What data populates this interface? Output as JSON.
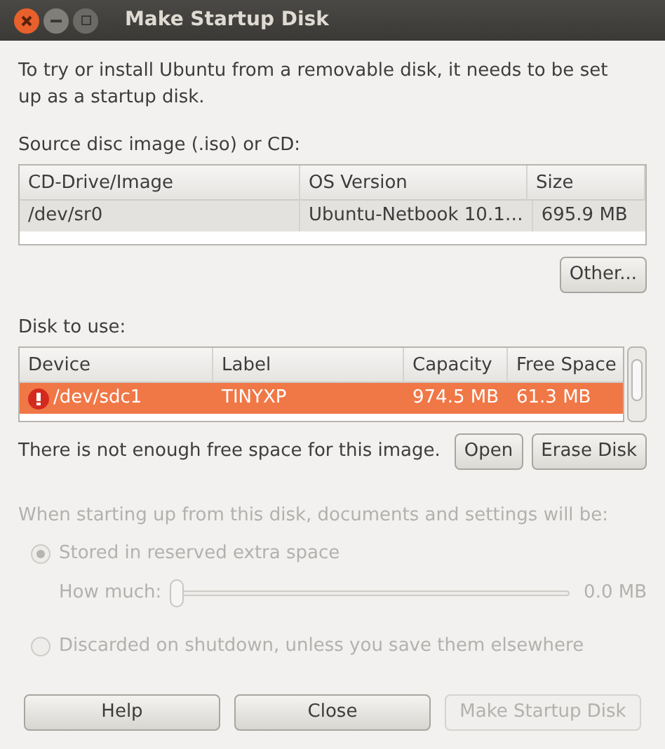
{
  "window": {
    "title": "Make Startup Disk"
  },
  "intro": "To try or install Ubuntu from a removable disk, it needs to be set up as a startup disk.",
  "source": {
    "label": "Source disc image (.iso) or CD:",
    "columns": [
      "CD-Drive/Image",
      "OS Version",
      "Size"
    ],
    "rows": [
      {
        "cells": [
          "/dev/sr0",
          "Ubuntu-Netbook 10.1…",
          "695.9 MB"
        ],
        "selected": true
      }
    ],
    "other_button": "Other..."
  },
  "disk": {
    "label": "Disk to use:",
    "columns": [
      "Device",
      "Label",
      "Capacity",
      "Free Space"
    ],
    "rows": [
      {
        "cells": [
          "/dev/sdc1",
          "TINYXP",
          "974.5 MB",
          "61.3 MB"
        ],
        "selected": true,
        "warning": true
      }
    ],
    "message": "There is not enough free space for this image.",
    "buttons": [
      "Open",
      "Erase Disk"
    ]
  },
  "persistence": {
    "label": "When starting up from this disk, documents and settings will be:",
    "disabled": true,
    "options": [
      {
        "label": "Stored in reserved extra space",
        "selected": true
      },
      {
        "label": "Discarded on shutdown, unless you save them elsewhere",
        "selected": false
      }
    ],
    "slider": {
      "label": "How much:",
      "level": 0,
      "reading": "0.0 MB"
    }
  },
  "buttons": [
    {
      "label": "Help",
      "disabled": false
    },
    {
      "label": "Close",
      "disabled": false
    },
    {
      "label": "Make Startup Disk",
      "disabled": true
    }
  ]
}
